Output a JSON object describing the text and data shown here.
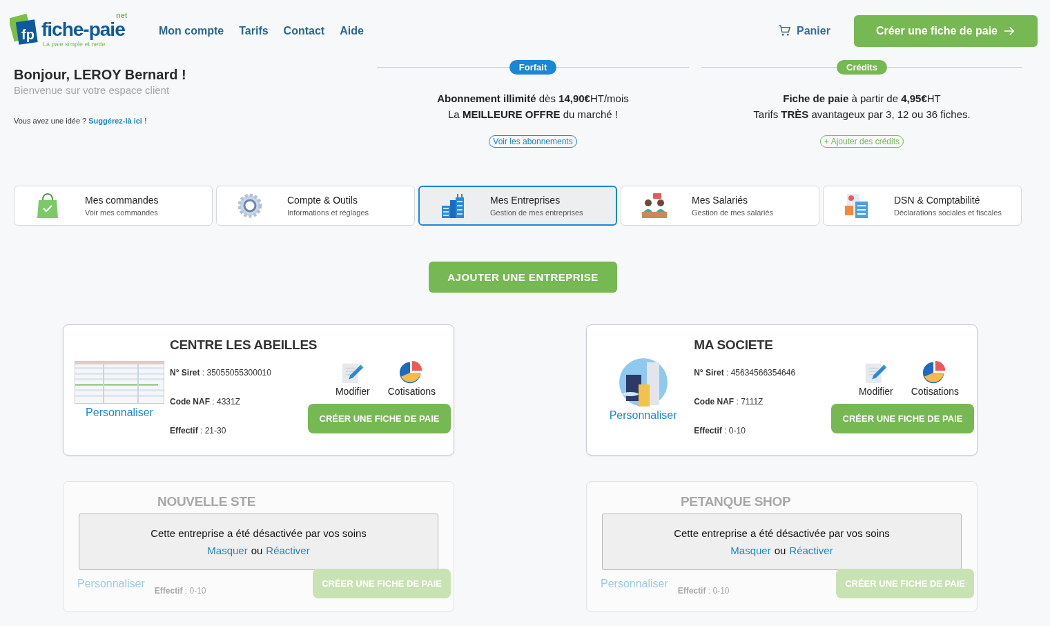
{
  "logo": {
    "mark": "fp",
    "name": "fiche-paie",
    "suffix": "net",
    "tagline": "La paie simple et nette"
  },
  "nav": [
    "Mon compte",
    "Tarifs",
    "Contact",
    "Aide"
  ],
  "cart": "Panier",
  "cta": "Créer une fiche de paie",
  "greeting": {
    "title": "Bonjour, LEROY Bernard !",
    "subtitle": "Bienvenue sur votre espace client",
    "idea": "Vous avez une idée ?",
    "idea_link": "Suggérez-là ici !"
  },
  "offers": [
    {
      "badge": "Forfait",
      "color": "#1a86d6",
      "lines": [
        "**Abonnement illimité** dès **14,90€**HT/mois",
        "La **MEILLEURE OFFRE** du marché !"
      ],
      "link": "Voir les abonnements"
    },
    {
      "badge": "Crédits",
      "color": "#76b852",
      "lines": [
        "**Fiche de paie** à partir de **4,95€**HT",
        "Tarifs **TRÈS** avantageux par 3, 12 ou 36 fiches."
      ],
      "link": "+ Ajouter des crédits"
    }
  ],
  "tiles": [
    {
      "kind": "bag",
      "title": "Mes commandes",
      "subtitle": "Voir mes commandes",
      "selected": false
    },
    {
      "kind": "gear",
      "title": "Compte & Outils",
      "subtitle": "Informations et réglages",
      "selected": false
    },
    {
      "kind": "buildings",
      "title": "Mes Entreprises",
      "subtitle": "Gestion de mes entreprises",
      "selected": true
    },
    {
      "kind": "people",
      "title": "Mes Salariés",
      "subtitle": "Gestion de mes salariés",
      "selected": false
    },
    {
      "kind": "calculator",
      "title": "DSN & Comptabilité",
      "subtitle": "Déclarations sociales et fiscales",
      "selected": false
    }
  ],
  "add_button": "AJOUTER UNE ENTREPRISE",
  "companies": [
    {
      "name": "CENTRE LES ABEILLES",
      "active": true,
      "customize": "Personnaliser",
      "siret": "**N° Siret** : 35055055300010",
      "naf": "**Code NAF** : 4331Z",
      "effectif": "**Effectif** : 21-30",
      "actions": [
        {
          "kind": "edit",
          "label": "Modifier"
        },
        {
          "kind": "pie",
          "label": "Cotisations"
        }
      ],
      "create": "CRÉER UNE FICHE DE PAIE"
    },
    {
      "name": "MA SOCIETE",
      "active": true,
      "customize": "Personnaliser",
      "siret": "**N° Siret** : 45634566354646",
      "naf": "**Code NAF** : 7111Z",
      "effectif": "**Effectif** : 0-10",
      "actions": [
        {
          "kind": "edit",
          "label": "Modifier"
        },
        {
          "kind": "pie",
          "label": "Cotisations"
        }
      ],
      "create": "CRÉER UNE FICHE DE PAIE"
    },
    {
      "name": "NOUVELLE STE",
      "active": false,
      "customize": "Personnaliser",
      "effectif": "**Effectif** : 0-10",
      "create": "CRÉER UNE FICHE DE PAIE",
      "notice": {
        "text": "Cette entreprise a été désactivée par vos soins",
        "hide": "Masquer",
        "separator": "ou",
        "reactivate": "Réactiver"
      }
    },
    {
      "name": "PETANQUE SHOP",
      "active": false,
      "customize": "Personnaliser",
      "effectif": "**Effectif** : 0-10",
      "create": "CRÉER UNE FICHE DE PAIE",
      "notice": {
        "text": "Cette entreprise a été désactivée par vos soins",
        "hide": "Masquer",
        "separator": "ou",
        "reactivate": "Réactiver"
      }
    }
  ]
}
